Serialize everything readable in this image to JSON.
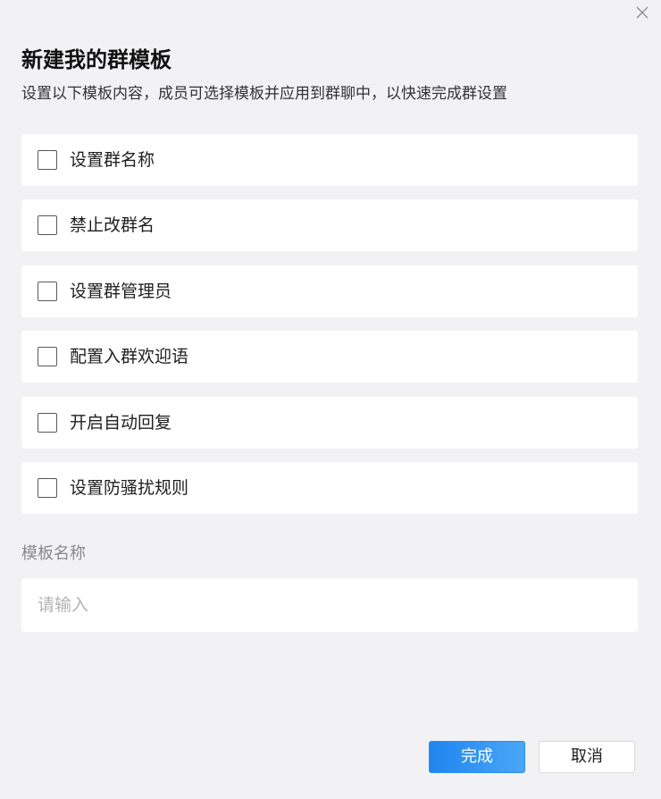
{
  "dialog": {
    "close_icon": "close-icon",
    "title": "新建我的群模板",
    "subtitle": "设置以下模板内容，成员可选择模板并应用到群聊中，以快速完成群设置"
  },
  "options": [
    {
      "label": "设置群名称",
      "checked": false
    },
    {
      "label": "禁止改群名",
      "checked": false
    },
    {
      "label": "设置群管理员",
      "checked": false
    },
    {
      "label": "配置入群欢迎语",
      "checked": false
    },
    {
      "label": "开启自动回复",
      "checked": false
    },
    {
      "label": "设置防骚扰规则",
      "checked": false
    }
  ],
  "template_name": {
    "label": "模板名称",
    "placeholder": "请输入",
    "value": ""
  },
  "buttons": {
    "confirm_label": "完成",
    "cancel_label": "取消"
  },
  "colors": {
    "background": "#f2f2f4",
    "card": "#ffffff",
    "primary": "#2d8ff0",
    "checkbox_border": "#595959",
    "muted_text": "#8a8a8a",
    "placeholder": "#b3b3b3"
  }
}
